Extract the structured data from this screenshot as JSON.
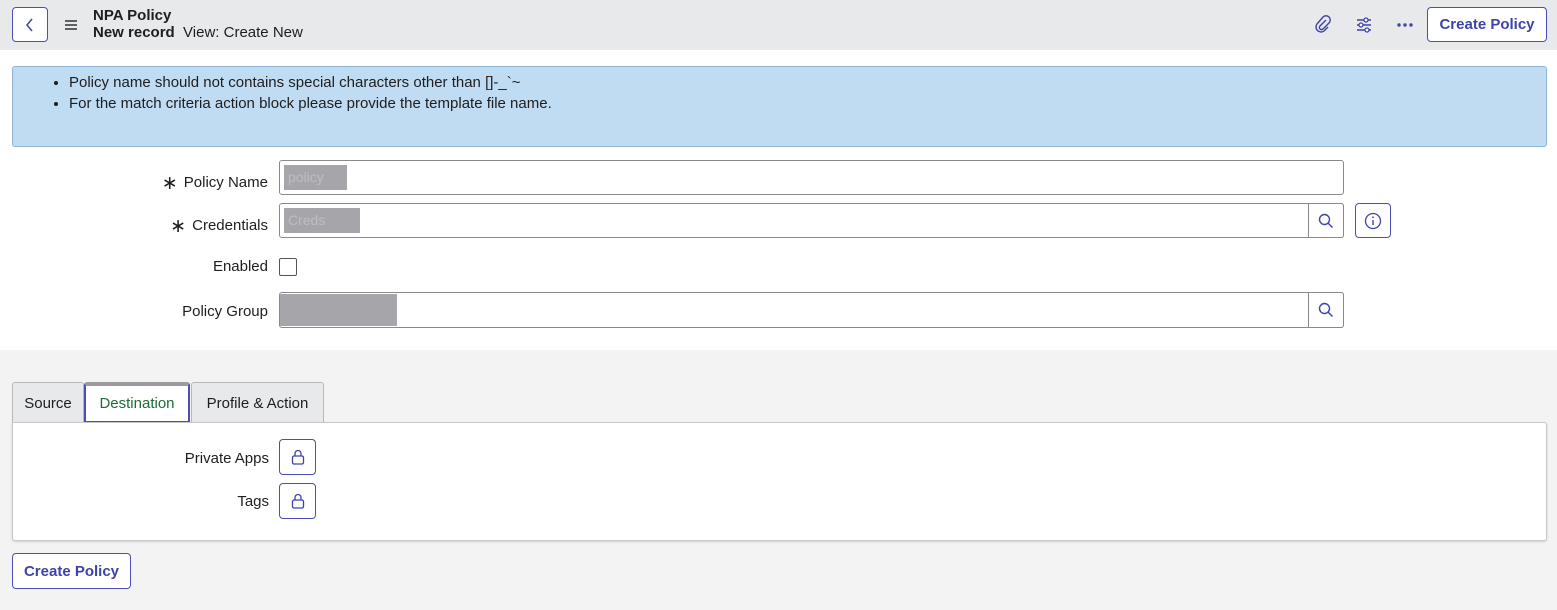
{
  "header": {
    "title": "NPA Policy",
    "record_state": "New record",
    "view_label": "View: Create New",
    "create_button": "Create Policy",
    "icons": [
      "chevron-left-icon",
      "hamburger-menu-icon",
      "paperclip-icon",
      "sliders-icon",
      "more-dots-icon"
    ]
  },
  "info_banner": {
    "items": [
      "Policy name should not contains special characters other than []-_`~",
      "For the match criteria action block please provide the template file name."
    ]
  },
  "form": {
    "required_mark": "∗",
    "policy_name": {
      "label": "Policy Name",
      "value": "policy"
    },
    "credentials": {
      "label": "Credentials",
      "value": "Creds"
    },
    "enabled": {
      "label": "Enabled",
      "checked": false
    },
    "policy_group": {
      "label": "Policy Group",
      "value": ""
    }
  },
  "tabs": {
    "items": [
      "Source",
      "Destination",
      "Profile & Action"
    ],
    "active": "Destination"
  },
  "destination": {
    "private_apps_label": "Private Apps",
    "tags_label": "Tags"
  },
  "footer": {
    "create_button": "Create Policy"
  },
  "colors": {
    "accent": "#4b4fb5",
    "banner": "#bfdcf2",
    "active_tab_text": "#1d6b3a"
  }
}
